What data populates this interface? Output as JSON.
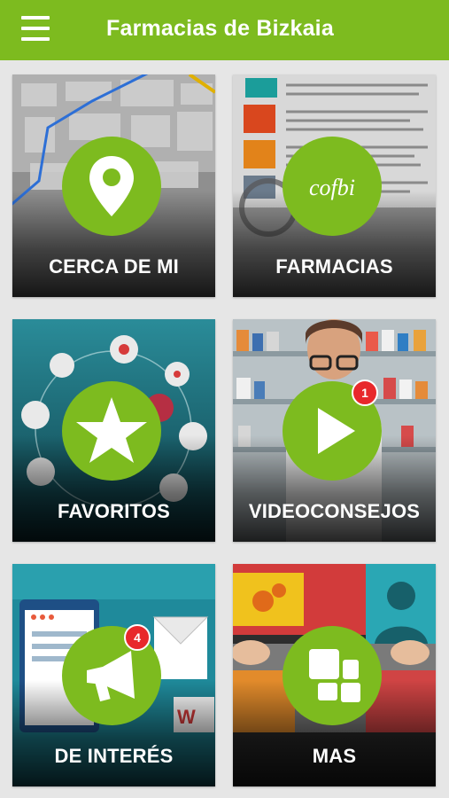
{
  "app": {
    "title": "Farmacias de Bizkaia",
    "accent": "#7dbb1f",
    "badge_color": "#e8282b"
  },
  "tiles": [
    {
      "label": "CERCA DE MI",
      "icon": "map-pin-icon"
    },
    {
      "label": "FARMACIAS",
      "icon": "cofbi-logo-icon",
      "logo_text": "cofbi"
    },
    {
      "label": "FAVORITOS",
      "icon": "star-icon"
    },
    {
      "label": "VIDEOCONSEJOS",
      "icon": "play-icon",
      "badge": "1"
    },
    {
      "label": "DE INTERÉS",
      "icon": "megaphone-icon",
      "badge": "4"
    },
    {
      "label": "MAS",
      "icon": "grid-icon"
    }
  ]
}
